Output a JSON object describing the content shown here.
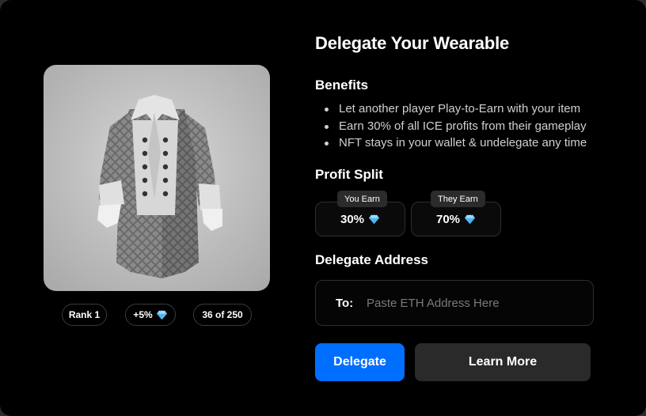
{
  "modal": {
    "title": "Delegate Your Wearable",
    "benefits_heading": "Benefits",
    "benefits": [
      "Let another player Play-to-Earn with your item",
      "Earn 30% of all ICE profits from their gameplay",
      "NFT stays in your wallet & undelegate any time"
    ],
    "profit_split_heading": "Profit Split",
    "you_earn": {
      "tag": "You Earn",
      "value": "30%"
    },
    "they_earn": {
      "tag": "They Earn",
      "value": "70%"
    },
    "address_heading": "Delegate Address",
    "address_prefix": "To:",
    "address_placeholder": "Paste ETH Address Here",
    "address_value": "",
    "delegate_label": "Delegate",
    "learn_more_label": "Learn More"
  },
  "wearable": {
    "rank": "Rank 1",
    "bonus": "+5%",
    "edition": "36 of 250"
  },
  "icons": {
    "gem": "diamond-gem-icon"
  },
  "colors": {
    "accent": "#006eff",
    "background": "#000000",
    "secondary_button": "#2a2a2a",
    "gem": "#7fd3ff"
  }
}
